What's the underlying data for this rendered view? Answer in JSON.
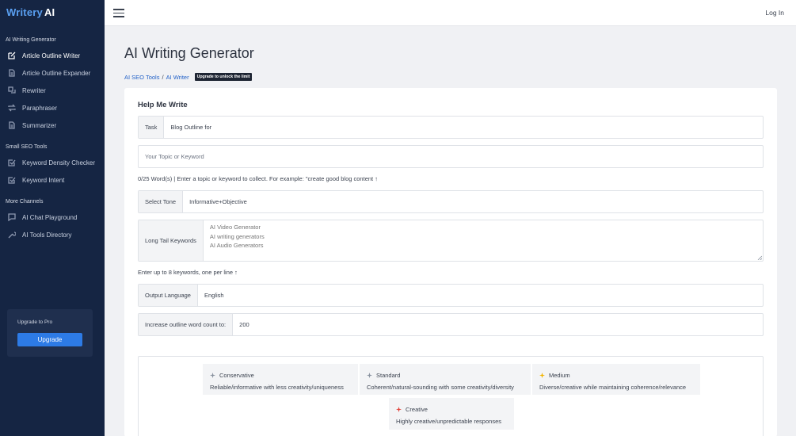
{
  "brand": {
    "name": "Writery",
    "suffix": "AI"
  },
  "sidebar": {
    "sections": [
      {
        "title": "AI Writing Generator"
      },
      {
        "title": "Small SEO Tools"
      },
      {
        "title": "More Channels"
      }
    ],
    "items": [
      {
        "label": "Article Outline Writer",
        "icon": "edit-icon"
      },
      {
        "label": "Article Outline Expander",
        "icon": "document-icon"
      },
      {
        "label": "Rewriter",
        "icon": "rewrite-icon"
      },
      {
        "label": "Paraphraser",
        "icon": "repeat-icon"
      },
      {
        "label": "Summarizer",
        "icon": "document-icon"
      },
      {
        "label": "Keyword Density Checker",
        "icon": "checkbox-icon"
      },
      {
        "label": "Keyword Intent",
        "icon": "checkbox-icon"
      },
      {
        "label": "AI Chat Playground",
        "icon": "chat-icon"
      },
      {
        "label": "AI Tools Directory",
        "icon": "tool-icon"
      }
    ],
    "upgrade": {
      "label": "Upgrade to Pro",
      "button": "Upgrade"
    }
  },
  "topbar": {
    "login": "Log In"
  },
  "main": {
    "title": "AI Writing Generator",
    "breadcrumb": {
      "first": "AI SEO Tools",
      "separator": "/",
      "second": "AI Writer",
      "badge": "Upgrade to unlock the limit"
    },
    "form": {
      "heading": "Help Me Write",
      "task": {
        "label": "Task",
        "value": "Blog Outline for"
      },
      "topic": {
        "placeholder": "Your Topic or Keyword"
      },
      "counter_hint": "0/25 Word(s) | Enter a topic or keyword to collect. For example: \"create good blog content ↑",
      "tone": {
        "label": "Select Tone",
        "value": "Informative+Objective"
      },
      "keywords": {
        "label": "Long Tail Keywords",
        "placeholder": "AI Video Generator\nAI writing generators\nAI Audio Generators"
      },
      "keywords_hint": "Enter up to 8 keywords, one per line ↑",
      "language": {
        "label": "Output Language",
        "value": "English"
      },
      "word_count": {
        "label": "Increase outline word count to:",
        "value": "200"
      }
    },
    "creativity": [
      {
        "title": "Conservative",
        "desc": "Reliable/informative with less creativity/uniqueness",
        "color": "#8a93a0"
      },
      {
        "title": "Standard",
        "desc": "Coherent/natural-sounding with some creativity/diversity",
        "color": "#8a93a0"
      },
      {
        "title": "Medium",
        "desc": "Diverse/creative while maintaining coherence/relevance",
        "color": "#f2b400"
      },
      {
        "title": "Creative",
        "desc": "Highly creative/unpredictable responses",
        "color": "#e2453c"
      }
    ]
  }
}
